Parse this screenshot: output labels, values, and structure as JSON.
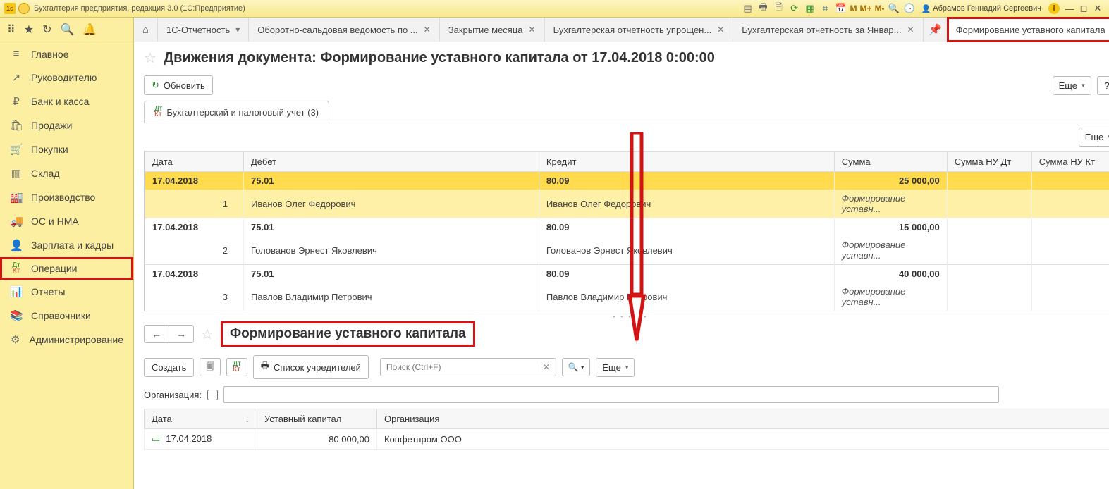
{
  "titlebar": {
    "text": "Бухгалтерия предприятия, редакция 3.0  (1С:Предприятие)",
    "user": "Абрамов Геннадий Сергеевич",
    "m1": "M",
    "m2": "M+",
    "m3": "M-"
  },
  "sidebar": {
    "items": [
      {
        "icon": "≡",
        "label": "Главное"
      },
      {
        "icon": "↗",
        "label": "Руководителю"
      },
      {
        "icon": "₽",
        "label": "Банк и касса"
      },
      {
        "icon": "🛍",
        "label": "Продажи"
      },
      {
        "icon": "🛒",
        "label": "Покупки"
      },
      {
        "icon": "▥",
        "label": "Склад"
      },
      {
        "icon": "🏭",
        "label": "Производство"
      },
      {
        "icon": "🚚",
        "label": "ОС и НМА"
      },
      {
        "icon": "👤",
        "label": "Зарплата и кадры"
      },
      {
        "icon": "ДтКт",
        "label": "Операции"
      },
      {
        "icon": "📊",
        "label": "Отчеты"
      },
      {
        "icon": "📚",
        "label": "Справочники"
      },
      {
        "icon": "⚙",
        "label": "Администрирование"
      }
    ]
  },
  "tabs": [
    {
      "label": "1С-Отчетность",
      "close": true
    },
    {
      "label": "Оборотно-сальдовая ведомость по ...",
      "close": true
    },
    {
      "label": "Закрытие месяца",
      "close": true
    },
    {
      "label": "Бухгалтерская отчетность упрощен...",
      "close": true
    },
    {
      "label": "Бухгалтерская отчетность за Январ...",
      "close": true
    },
    {
      "label": "Формирование уставного капитала",
      "close": true
    }
  ],
  "page": {
    "title": "Движения документа: Формирование уставного капитала от 17.04.2018 0:00:00",
    "refresh": "Обновить",
    "more": "Еще",
    "help": "?",
    "subtab": "Бухгалтерский и налоговый учет (3)"
  },
  "grid": {
    "headers": {
      "date": "Дата",
      "debit": "Дебет",
      "credit": "Кредит",
      "sum": "Сумма",
      "sumNuDt": "Сумма НУ Дт",
      "sumNuKt": "Сумма НУ Кт"
    },
    "rows": [
      {
        "date": "17.04.2018",
        "n": "1",
        "debit": "75.01",
        "dsub": "Иванов Олег Федорович",
        "credit": "80.09",
        "csub": "Иванов Олег Федорович",
        "sum": "25 000,00",
        "note": "Формирование уставн...",
        "sel": true
      },
      {
        "date": "17.04.2018",
        "n": "2",
        "debit": "75.01",
        "dsub": "Голованов Эрнест Яковлевич",
        "credit": "80.09",
        "csub": "Голованов Эрнест Яковлевич",
        "sum": "15 000,00",
        "note": "Формирование уставн..."
      },
      {
        "date": "17.04.2018",
        "n": "3",
        "debit": "75.01",
        "dsub": "Павлов Владимир Петрович",
        "credit": "80.09",
        "csub": "Павлов Владимир Петрович",
        "sum": "40 000,00",
        "note": "Формирование уставн..."
      }
    ]
  },
  "lower": {
    "title": "Формирование уставного капитала",
    "create": "Создать",
    "founders": "Список учредителей",
    "search_ph": "Поиск (Ctrl+F)",
    "more": "Еще",
    "org_label": "Организация:",
    "headers": {
      "date": "Дата",
      "cap": "Уставный капитал",
      "org": "Организация"
    },
    "rows": [
      {
        "date": "17.04.2018",
        "cap": "80 000,00",
        "org": "Конфетпром ООО"
      }
    ]
  }
}
